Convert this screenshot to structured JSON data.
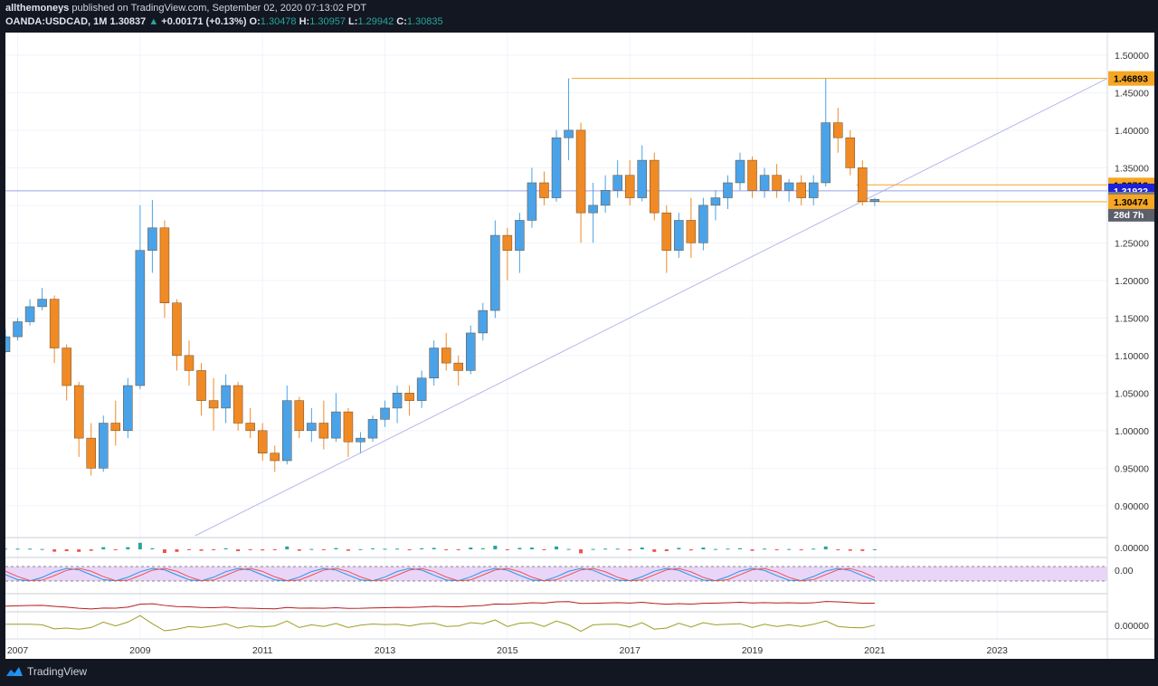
{
  "header": {
    "author": "allthemoneys",
    "published": "published on TradingView.com, September 02, 2020 07:13:02 PDT",
    "symbol": "OANDA:USDCAD, 1M",
    "last": "1.30837",
    "arrow": "▲",
    "change": "+0.00171 (+0.13%)",
    "o_label": "O:",
    "o_value": "1.30478",
    "h_label": "H:",
    "h_value": "1.30957",
    "l_label": "L:",
    "l_value": "1.29942",
    "c_label": "C:",
    "c_value": "1.30835"
  },
  "footer": {
    "logo_text": "TradingView",
    "logo_icon": "tradingview-logo-icon"
  },
  "colors": {
    "up": "#4aa3e8",
    "down": "#f08a24",
    "wick": "#555555",
    "hline": "#f5a623",
    "trendline": "#b7b7ef",
    "grid": "#f0f3fa"
  },
  "chart_data": {
    "type": "candlestick",
    "symbol": "OANDA:USDCAD",
    "interval": "1M",
    "ylim": [
      0.86,
      1.53
    ],
    "y_ticks": [
      "1.50000",
      "1.45000",
      "1.40000",
      "1.35000",
      "1.30000",
      "1.25000",
      "1.20000",
      "1.15000",
      "1.10000",
      "1.05000",
      "1.00000",
      "0.95000",
      "0.90000"
    ],
    "x_ticks": [
      "2007",
      "2009",
      "2011",
      "2013",
      "2015",
      "2017",
      "2019",
      "2021",
      "2023"
    ],
    "xlim": [
      2006.8,
      2024.8
    ],
    "price_labels": [
      {
        "text": "1.46893",
        "value": 1.46893,
        "style": "orange"
      },
      {
        "text": "1.32718",
        "value": 1.32718,
        "style": "orange"
      },
      {
        "text": "1.31922",
        "value": 1.31922,
        "style": "blue"
      },
      {
        "text": "1.30835",
        "value": 1.30835,
        "style": "gray"
      },
      {
        "text": "28d 7h",
        "value": 1.288,
        "style": "darkgray"
      },
      {
        "text": "1.30474",
        "value": 1.30474,
        "style": "orange"
      }
    ],
    "horizontal_lines": [
      {
        "value": 1.46893,
        "from": 2016.05,
        "to": 2024.8,
        "style": "orange"
      },
      {
        "value": 1.32718,
        "from": 2020.7,
        "to": 2024.8,
        "style": "orange"
      },
      {
        "value": 1.30474,
        "from": 2020.7,
        "to": 2024.8,
        "style": "orange"
      },
      {
        "value": 1.31922,
        "from": 2006.8,
        "to": 2024.8,
        "style": "blue"
      }
    ],
    "trendline": {
      "x1": 2009.9,
      "y1": 0.86,
      "x2": 2024.8,
      "y2": 1.4689
    },
    "candles": [
      {
        "t": 2006.8,
        "o": 1.105,
        "h": 1.135,
        "l": 1.103,
        "c": 1.125
      },
      {
        "t": 2007.0,
        "o": 1.125,
        "h": 1.15,
        "l": 1.12,
        "c": 1.145
      },
      {
        "t": 2007.2,
        "o": 1.145,
        "h": 1.175,
        "l": 1.14,
        "c": 1.165
      },
      {
        "t": 2007.4,
        "o": 1.165,
        "h": 1.19,
        "l": 1.16,
        "c": 1.175
      },
      {
        "t": 2007.6,
        "o": 1.175,
        "h": 1.18,
        "l": 1.09,
        "c": 1.11
      },
      {
        "t": 2007.8,
        "o": 1.11,
        "h": 1.115,
        "l": 1.04,
        "c": 1.06
      },
      {
        "t": 2008.0,
        "o": 1.06,
        "h": 1.065,
        "l": 0.965,
        "c": 0.99
      },
      {
        "t": 2008.2,
        "o": 0.99,
        "h": 1.01,
        "l": 0.94,
        "c": 0.95
      },
      {
        "t": 2008.4,
        "o": 0.95,
        "h": 1.02,
        "l": 0.945,
        "c": 1.01
      },
      {
        "t": 2008.6,
        "o": 1.01,
        "h": 1.04,
        "l": 0.98,
        "c": 1.0
      },
      {
        "t": 2008.8,
        "o": 1.0,
        "h": 1.07,
        "l": 0.99,
        "c": 1.06
      },
      {
        "t": 2009.0,
        "o": 1.06,
        "h": 1.3,
        "l": 1.055,
        "c": 1.24
      },
      {
        "t": 2009.2,
        "o": 1.24,
        "h": 1.307,
        "l": 1.21,
        "c": 1.27
      },
      {
        "t": 2009.4,
        "o": 1.27,
        "h": 1.28,
        "l": 1.15,
        "c": 1.17
      },
      {
        "t": 2009.6,
        "o": 1.17,
        "h": 1.175,
        "l": 1.08,
        "c": 1.1
      },
      {
        "t": 2009.8,
        "o": 1.1,
        "h": 1.12,
        "l": 1.06,
        "c": 1.08
      },
      {
        "t": 2010.0,
        "o": 1.08,
        "h": 1.09,
        "l": 1.02,
        "c": 1.04
      },
      {
        "t": 2010.2,
        "o": 1.04,
        "h": 1.07,
        "l": 1.0,
        "c": 1.03
      },
      {
        "t": 2010.4,
        "o": 1.03,
        "h": 1.075,
        "l": 1.01,
        "c": 1.06
      },
      {
        "t": 2010.6,
        "o": 1.06,
        "h": 1.065,
        "l": 1.0,
        "c": 1.01
      },
      {
        "t": 2010.8,
        "o": 1.01,
        "h": 1.03,
        "l": 0.99,
        "c": 1.0
      },
      {
        "t": 2011.0,
        "o": 1.0,
        "h": 1.01,
        "l": 0.96,
        "c": 0.97
      },
      {
        "t": 2011.2,
        "o": 0.97,
        "h": 0.98,
        "l": 0.945,
        "c": 0.96
      },
      {
        "t": 2011.4,
        "o": 0.96,
        "h": 1.06,
        "l": 0.955,
        "c": 1.04
      },
      {
        "t": 2011.6,
        "o": 1.04,
        "h": 1.045,
        "l": 0.99,
        "c": 1.0
      },
      {
        "t": 2011.8,
        "o": 1.0,
        "h": 1.03,
        "l": 0.985,
        "c": 1.01
      },
      {
        "t": 2012.0,
        "o": 1.01,
        "h": 1.04,
        "l": 0.975,
        "c": 0.99
      },
      {
        "t": 2012.2,
        "o": 0.99,
        "h": 1.05,
        "l": 0.985,
        "c": 1.025
      },
      {
        "t": 2012.4,
        "o": 1.025,
        "h": 1.03,
        "l": 0.965,
        "c": 0.985
      },
      {
        "t": 2012.6,
        "o": 0.985,
        "h": 0.998,
        "l": 0.97,
        "c": 0.99
      },
      {
        "t": 2012.8,
        "o": 0.99,
        "h": 1.02,
        "l": 0.985,
        "c": 1.015
      },
      {
        "t": 2013.0,
        "o": 1.015,
        "h": 1.04,
        "l": 1.005,
        "c": 1.03
      },
      {
        "t": 2013.2,
        "o": 1.03,
        "h": 1.06,
        "l": 1.01,
        "c": 1.05
      },
      {
        "t": 2013.4,
        "o": 1.05,
        "h": 1.06,
        "l": 1.02,
        "c": 1.04
      },
      {
        "t": 2013.6,
        "o": 1.04,
        "h": 1.08,
        "l": 1.03,
        "c": 1.07
      },
      {
        "t": 2013.8,
        "o": 1.07,
        "h": 1.12,
        "l": 1.06,
        "c": 1.11
      },
      {
        "t": 2014.0,
        "o": 1.11,
        "h": 1.13,
        "l": 1.08,
        "c": 1.09
      },
      {
        "t": 2014.2,
        "o": 1.09,
        "h": 1.1,
        "l": 1.06,
        "c": 1.08
      },
      {
        "t": 2014.4,
        "o": 1.08,
        "h": 1.14,
        "l": 1.075,
        "c": 1.13
      },
      {
        "t": 2014.6,
        "o": 1.13,
        "h": 1.17,
        "l": 1.12,
        "c": 1.16
      },
      {
        "t": 2014.8,
        "o": 1.16,
        "h": 1.28,
        "l": 1.15,
        "c": 1.26
      },
      {
        "t": 2015.0,
        "o": 1.26,
        "h": 1.27,
        "l": 1.2,
        "c": 1.24
      },
      {
        "t": 2015.2,
        "o": 1.24,
        "h": 1.29,
        "l": 1.21,
        "c": 1.28
      },
      {
        "t": 2015.4,
        "o": 1.28,
        "h": 1.35,
        "l": 1.27,
        "c": 1.33
      },
      {
        "t": 2015.6,
        "o": 1.33,
        "h": 1.345,
        "l": 1.3,
        "c": 1.31
      },
      {
        "t": 2015.8,
        "o": 1.31,
        "h": 1.4,
        "l": 1.305,
        "c": 1.39
      },
      {
        "t": 2016.0,
        "o": 1.39,
        "h": 1.469,
        "l": 1.36,
        "c": 1.4
      },
      {
        "t": 2016.2,
        "o": 1.4,
        "h": 1.41,
        "l": 1.25,
        "c": 1.29
      },
      {
        "t": 2016.4,
        "o": 1.29,
        "h": 1.33,
        "l": 1.25,
        "c": 1.3
      },
      {
        "t": 2016.6,
        "o": 1.3,
        "h": 1.34,
        "l": 1.29,
        "c": 1.32
      },
      {
        "t": 2016.8,
        "o": 1.32,
        "h": 1.36,
        "l": 1.31,
        "c": 1.34
      },
      {
        "t": 2017.0,
        "o": 1.34,
        "h": 1.36,
        "l": 1.3,
        "c": 1.31
      },
      {
        "t": 2017.2,
        "o": 1.31,
        "h": 1.38,
        "l": 1.305,
        "c": 1.36
      },
      {
        "t": 2017.4,
        "o": 1.36,
        "h": 1.37,
        "l": 1.28,
        "c": 1.29
      },
      {
        "t": 2017.6,
        "o": 1.29,
        "h": 1.3,
        "l": 1.21,
        "c": 1.24
      },
      {
        "t": 2017.8,
        "o": 1.24,
        "h": 1.29,
        "l": 1.23,
        "c": 1.28
      },
      {
        "t": 2018.0,
        "o": 1.28,
        "h": 1.31,
        "l": 1.23,
        "c": 1.25
      },
      {
        "t": 2018.2,
        "o": 1.25,
        "h": 1.31,
        "l": 1.24,
        "c": 1.3
      },
      {
        "t": 2018.4,
        "o": 1.3,
        "h": 1.32,
        "l": 1.28,
        "c": 1.31
      },
      {
        "t": 2018.6,
        "o": 1.31,
        "h": 1.34,
        "l": 1.295,
        "c": 1.33
      },
      {
        "t": 2018.8,
        "o": 1.33,
        "h": 1.37,
        "l": 1.32,
        "c": 1.36
      },
      {
        "t": 2019.0,
        "o": 1.36,
        "h": 1.365,
        "l": 1.31,
        "c": 1.32
      },
      {
        "t": 2019.2,
        "o": 1.32,
        "h": 1.35,
        "l": 1.31,
        "c": 1.34
      },
      {
        "t": 2019.4,
        "o": 1.34,
        "h": 1.355,
        "l": 1.31,
        "c": 1.32
      },
      {
        "t": 2019.6,
        "o": 1.32,
        "h": 1.335,
        "l": 1.305,
        "c": 1.33
      },
      {
        "t": 2019.8,
        "o": 1.33,
        "h": 1.34,
        "l": 1.3,
        "c": 1.31
      },
      {
        "t": 2020.0,
        "o": 1.31,
        "h": 1.34,
        "l": 1.3,
        "c": 1.33
      },
      {
        "t": 2020.2,
        "o": 1.33,
        "h": 1.469,
        "l": 1.325,
        "c": 1.41
      },
      {
        "t": 2020.4,
        "o": 1.41,
        "h": 1.43,
        "l": 1.37,
        "c": 1.39
      },
      {
        "t": 2020.6,
        "o": 1.39,
        "h": 1.4,
        "l": 1.34,
        "c": 1.35
      },
      {
        "t": 2020.8,
        "o": 1.35,
        "h": 1.36,
        "l": 1.3,
        "c": 1.305
      },
      {
        "t": 2021.0,
        "o": 1.305,
        "h": 1.31,
        "l": 1.299,
        "c": 1.308
      }
    ],
    "indicators": [
      {
        "name": "histogram",
        "value_label": "0.00000"
      },
      {
        "name": "stochastic",
        "value_label": "0.00"
      },
      {
        "name": "line",
        "value_label": ""
      },
      {
        "name": "oscillator",
        "value_label": "0.00000"
      }
    ]
  }
}
